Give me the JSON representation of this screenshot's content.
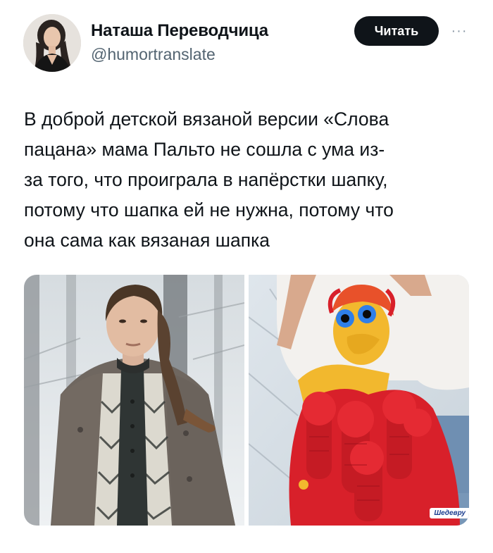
{
  "author": {
    "name": "Наташа Переводчица",
    "handle": "@humortranslate"
  },
  "actions": {
    "follow_label": "Читать",
    "more_label": "···"
  },
  "tweet": {
    "lines": [
      "В доброй детской вязаной версии «Слова",
      "пацана» мама Пальто не сошла с ума из-",
      "за того, что проиграла в напёрстки шапку,",
      "потому что шапка ей не нужна, потому что",
      "она сама как вязаная шапка"
    ]
  },
  "media": {
    "watermark": "Шедевру"
  },
  "colors": {
    "text": "#0f1419",
    "handle": "#536471",
    "button_bg": "#0f1419",
    "button_text": "#ffffff",
    "knit_red": "#d8202a",
    "knit_yellow": "#f2b82e",
    "eye_blue": "#2f7fe8"
  },
  "icons": [
    "avatar-photo",
    "more-dots-icon"
  ]
}
